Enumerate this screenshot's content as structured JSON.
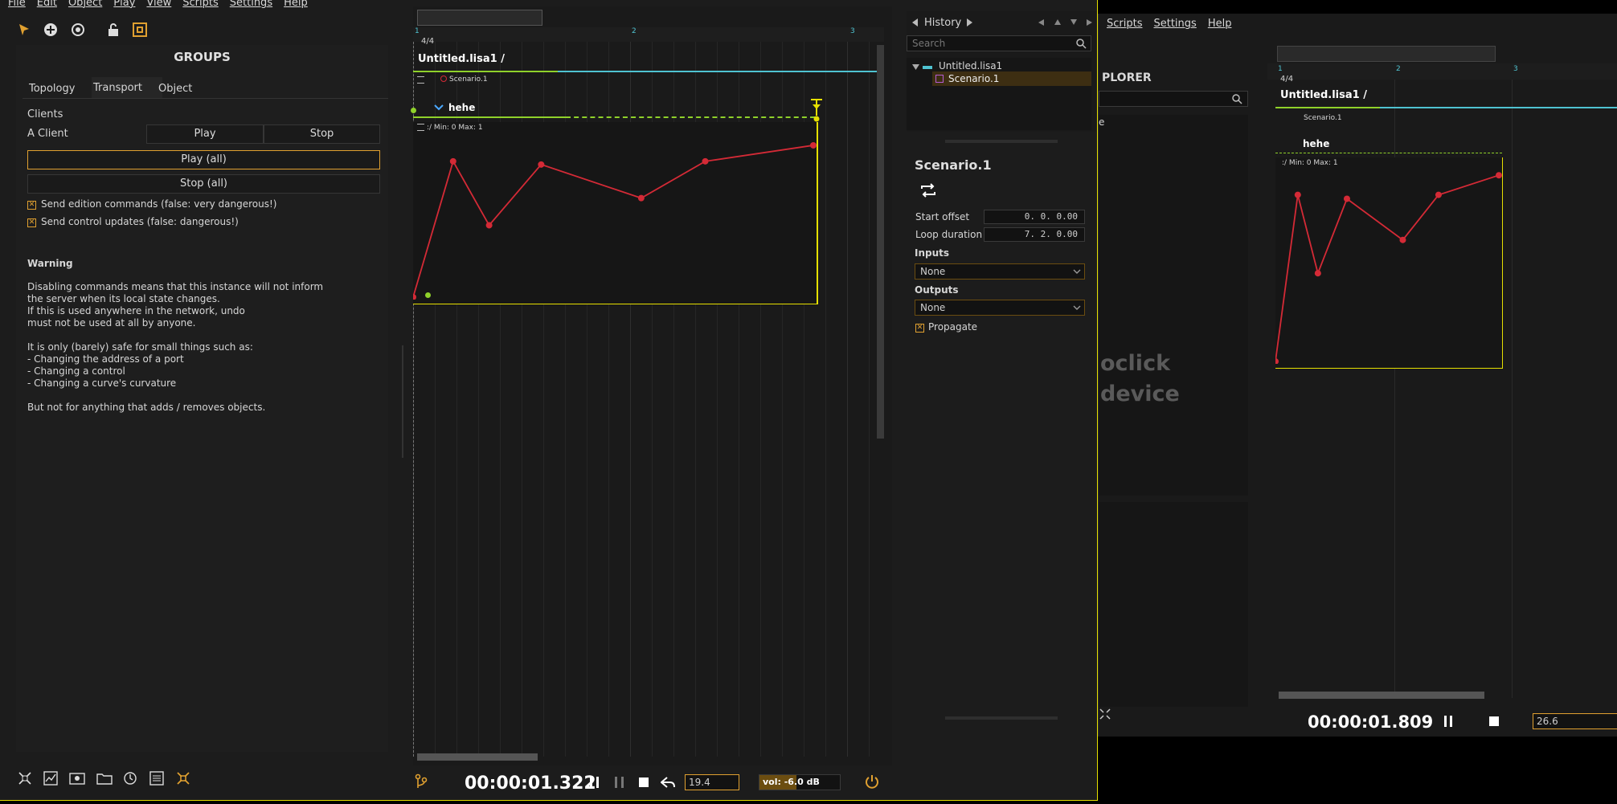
{
  "menu_left": [
    "File",
    "Edit",
    "Object",
    "Play",
    "View",
    "Scripts",
    "Settings",
    "Help"
  ],
  "menu_right": [
    "Scripts",
    "Settings",
    "Help"
  ],
  "colors": {
    "accent": "#e0a030",
    "curve": "#d42a36",
    "green": "#8fd12a",
    "cyan": "#4fc3d1",
    "yellow": "#e6e000"
  },
  "groups": {
    "title": "GROUPS",
    "tabs": [
      "Topology",
      "Transport",
      "Object"
    ],
    "clients_label": "Clients",
    "client_name": "A Client",
    "play": "Play",
    "stop": "Stop",
    "play_all": "Play (all)",
    "stop_all": "Stop (all)",
    "send_edition": "Send edition commands (false: very dangerous!)",
    "send_control": "Send control updates (false: dangerous!)",
    "warning_title": "Warning",
    "warning_lines": [
      "Disabling commands means that this instance will not inform",
      "the server when its local state changes.",
      "If this is used anywhere in the network, undo",
      "must not be used at all by anyone.",
      "",
      "It is only (barely) safe for small things such as:",
      "- Changing the address of a port",
      "- Changing a control",
      "- Changing a curve's curvature",
      "",
      "But not for anything that adds / removes objects."
    ]
  },
  "timeline": {
    "ruler": [
      "1",
      "2",
      "3"
    ],
    "time_sig": "4/4",
    "doc_title": "Untitled.lisa1 /",
    "scenario_label": "Scenario.1",
    "interval_name": "hehe",
    "curve_range": ":/ Min: 0 Max: 1",
    "curve_points": [
      0.0,
      0.85,
      0.45,
      0.83,
      0.62,
      0.85,
      0.95
    ],
    "transport_time": "00:00:01.322",
    "speed": "19.4",
    "volume": "vol: -6.0 dB"
  },
  "history": {
    "title": "History",
    "search_placeholder": "Search",
    "root": "Untitled.lisa1",
    "child": "Scenario.1"
  },
  "inspector": {
    "title": "Scenario.1",
    "start_offset_label": "Start offset",
    "start_offset": "0. 0. 0.00",
    "loop_duration_label": "Loop duration",
    "loop_duration": "7. 2. 0.00",
    "inputs_label": "Inputs",
    "inputs_value": "None",
    "outputs_label": "Outputs",
    "outputs_value": "None",
    "propagate": "Propagate"
  },
  "second": {
    "explorer": "PLORER",
    "explorer_partial": "e",
    "hint_1": "oclick",
    "hint_2": "device",
    "ruler": [
      "1",
      "2",
      "3"
    ],
    "time_sig": "4/4",
    "doc_title": "Untitled.lisa1 /",
    "scenario_label": "Scenario.1",
    "interval_name": "hehe",
    "curve_range": ":/ Min: 0 Max: 1",
    "curve_points": [
      0.0,
      0.85,
      0.45,
      0.83,
      0.62,
      0.85,
      0.95
    ],
    "transport_time": "00:00:01.809",
    "speed": "26.6"
  }
}
